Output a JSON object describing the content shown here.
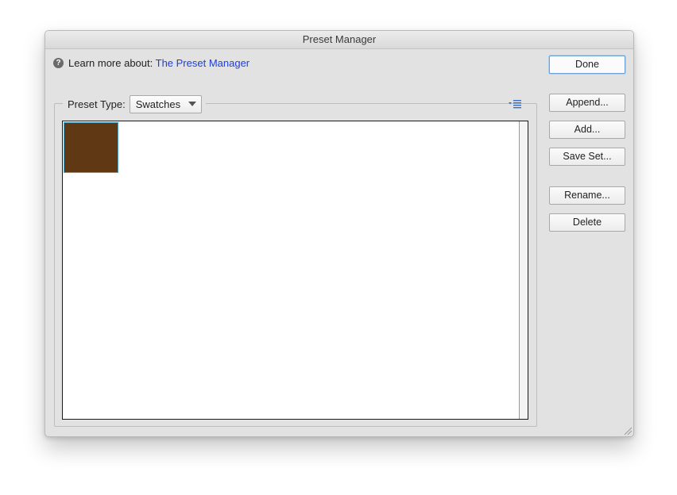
{
  "window": {
    "title": "Preset Manager"
  },
  "help": {
    "icon": "help-icon",
    "prefix": "Learn more about:",
    "link_text": "The Preset Manager",
    "link_color": "#1c3ee0"
  },
  "preset_type": {
    "label": "Preset Type:",
    "selected": "Swatches"
  },
  "flyout": {
    "icon": "panel-menu-icon"
  },
  "swatches": [
    {
      "color": "#603813"
    }
  ],
  "buttons": {
    "done": "Done",
    "append": "Append...",
    "add": "Add...",
    "save_set": "Save Set...",
    "rename": "Rename...",
    "delete": "Delete"
  },
  "colors": {
    "dialog_bg": "#e2e2e2",
    "default_button_ring": "#6aa2d8",
    "swatch_selection": "#4fa3c4"
  }
}
